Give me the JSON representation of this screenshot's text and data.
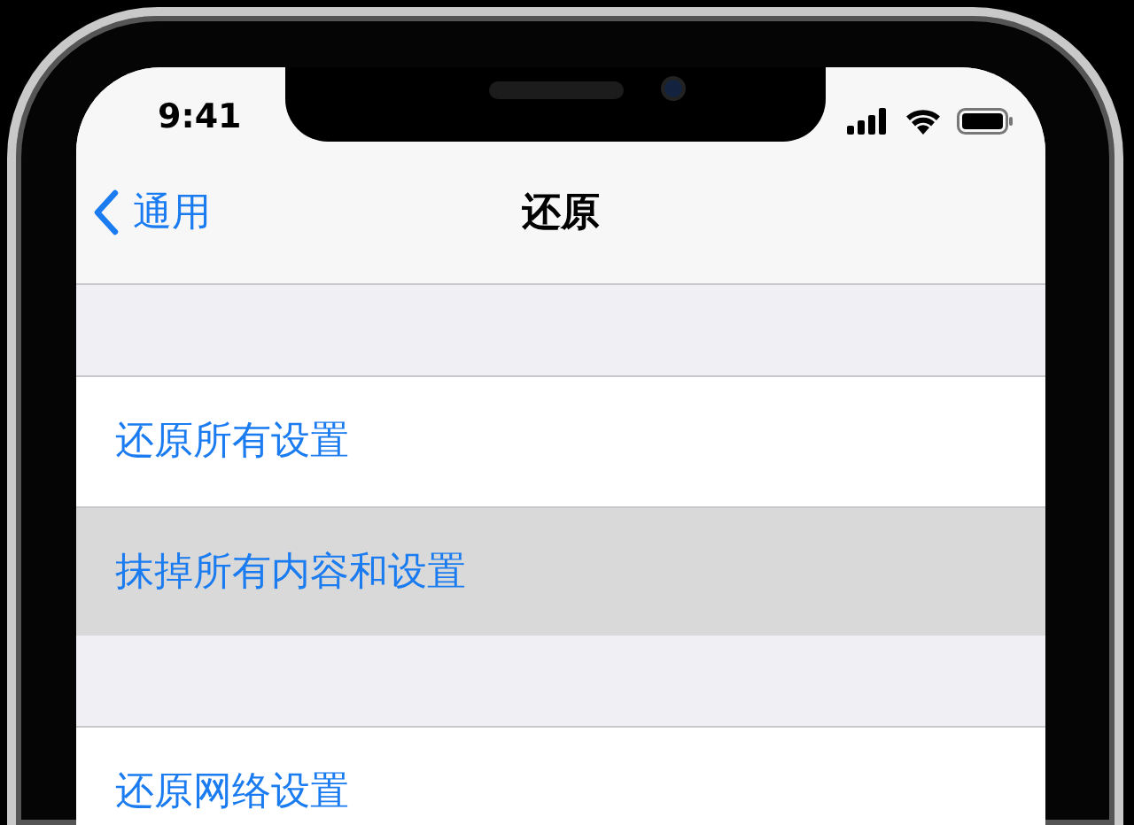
{
  "status_bar": {
    "time": "9:41"
  },
  "nav": {
    "back": "通用",
    "title": "还原"
  },
  "groups": [
    {
      "rows": [
        {
          "label": "还原所有设置",
          "selected": false
        },
        {
          "label": "抹掉所有内容和设置",
          "selected": true
        }
      ]
    },
    {
      "rows": [
        {
          "label": "还原网络设置",
          "selected": false
        }
      ]
    }
  ]
}
